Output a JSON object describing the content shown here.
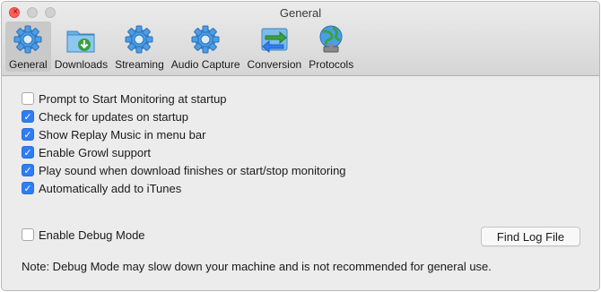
{
  "window": {
    "title": "General"
  },
  "toolbar": {
    "items": [
      {
        "label": "General",
        "icon": "gear-icon",
        "active": true
      },
      {
        "label": "Downloads",
        "icon": "download-folder-icon"
      },
      {
        "label": "Streaming",
        "icon": "gear-icon"
      },
      {
        "label": "Audio Capture",
        "icon": "gear-icon"
      },
      {
        "label": "Conversion",
        "icon": "conversion-arrows-icon"
      },
      {
        "label": "Protocols",
        "icon": "network-globe-icon"
      }
    ]
  },
  "options": [
    {
      "label": "Prompt to Start Monitoring at startup",
      "checked": false
    },
    {
      "label": "Check for updates on startup",
      "checked": true
    },
    {
      "label": "Show Replay Music in menu bar",
      "checked": true
    },
    {
      "label": "Enable Growl support",
      "checked": true
    },
    {
      "label": "Play sound when download finishes or start/stop monitoring",
      "checked": true
    },
    {
      "label": "Automatically add to iTunes",
      "checked": true
    }
  ],
  "debug": {
    "label": "Enable Debug Mode",
    "checked": false
  },
  "find_log_button": "Find Log File",
  "note": "Note: Debug Mode may slow down your machine and is not recommended for general use.",
  "colors": {
    "checkbox_on": "#2f7cf6",
    "gear": "#4a9ee8",
    "close_light": "#ff5f57"
  }
}
